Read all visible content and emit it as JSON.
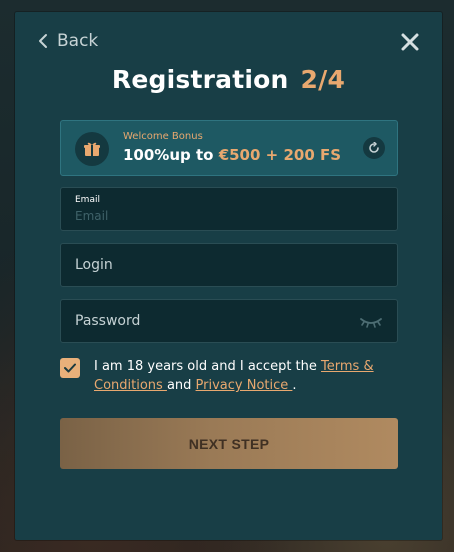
{
  "header": {
    "back_label": "Back",
    "title": "Registration",
    "step": "2/4"
  },
  "bonus": {
    "caption": "Welcome Bonus",
    "lead": "100%up to ",
    "amount": "€500 + 200 FS",
    "icon": "gift-icon"
  },
  "form": {
    "email_label": "Email",
    "email_placeholder": "Email",
    "login_placeholder": "Login",
    "password_placeholder": "Password"
  },
  "consent": {
    "checked": true,
    "text_before": "I am 18 years old and I accept the ",
    "terms_link": "Terms & Conditions ",
    "middle": " and ",
    "privacy_link": "Privacy Notice ",
    "end": "."
  },
  "actions": {
    "next_label": "NEXT STEP"
  },
  "colors": {
    "modal_bg": "#183e46",
    "accent": "#e8a86f",
    "field_bg": "#0d2a30"
  }
}
